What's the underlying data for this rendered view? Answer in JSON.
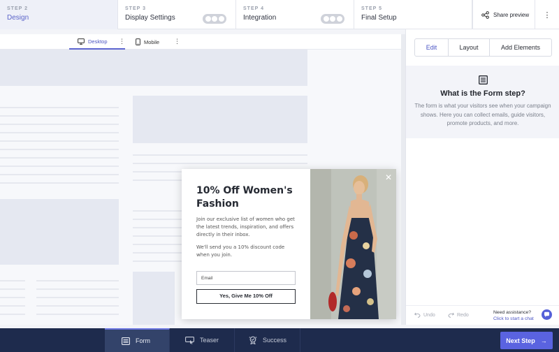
{
  "steps": [
    {
      "num": "STEP 2",
      "title": "Design"
    },
    {
      "num": "STEP 3",
      "title": "Display Settings"
    },
    {
      "num": "STEP 4",
      "title": "Integration"
    },
    {
      "num": "STEP 5",
      "title": "Final Setup"
    }
  ],
  "header": {
    "share_label": "Share preview",
    "more_icon": "kebab-vertical-icon"
  },
  "device_tabs": {
    "desktop": "Desktop",
    "mobile": "Mobile"
  },
  "popup": {
    "title": "10% Off Women's Fashion",
    "body1": "Join our exclusive list of women who get the latest trends, inspiration, and offers directly in their inbox.",
    "body2": "We'll send you a 10% discount code when you join.",
    "email_placeholder": "Email",
    "cta_label": "Yes, Give Me 10% Off"
  },
  "panel": {
    "tabs": [
      "Edit",
      "Layout",
      "Add Elements"
    ],
    "selected_tab": "Edit",
    "info_title": "What is the Form step?",
    "info_text": "The form is what your visitors see when your campaign shows. Here you can collect emails, guide visitors, promote products, and more.",
    "undo_label": "Undo",
    "redo_label": "Redo",
    "assist_title": "Need assistance?",
    "assist_link": "Click to start a chat"
  },
  "bottom_tabs": [
    "Form",
    "Teaser",
    "Success"
  ],
  "next_step_label": "Next Step",
  "colors": {
    "accent": "#5a63e0",
    "bottom_bar": "#1e2b4d",
    "active_step_text": "#5a63c9"
  }
}
